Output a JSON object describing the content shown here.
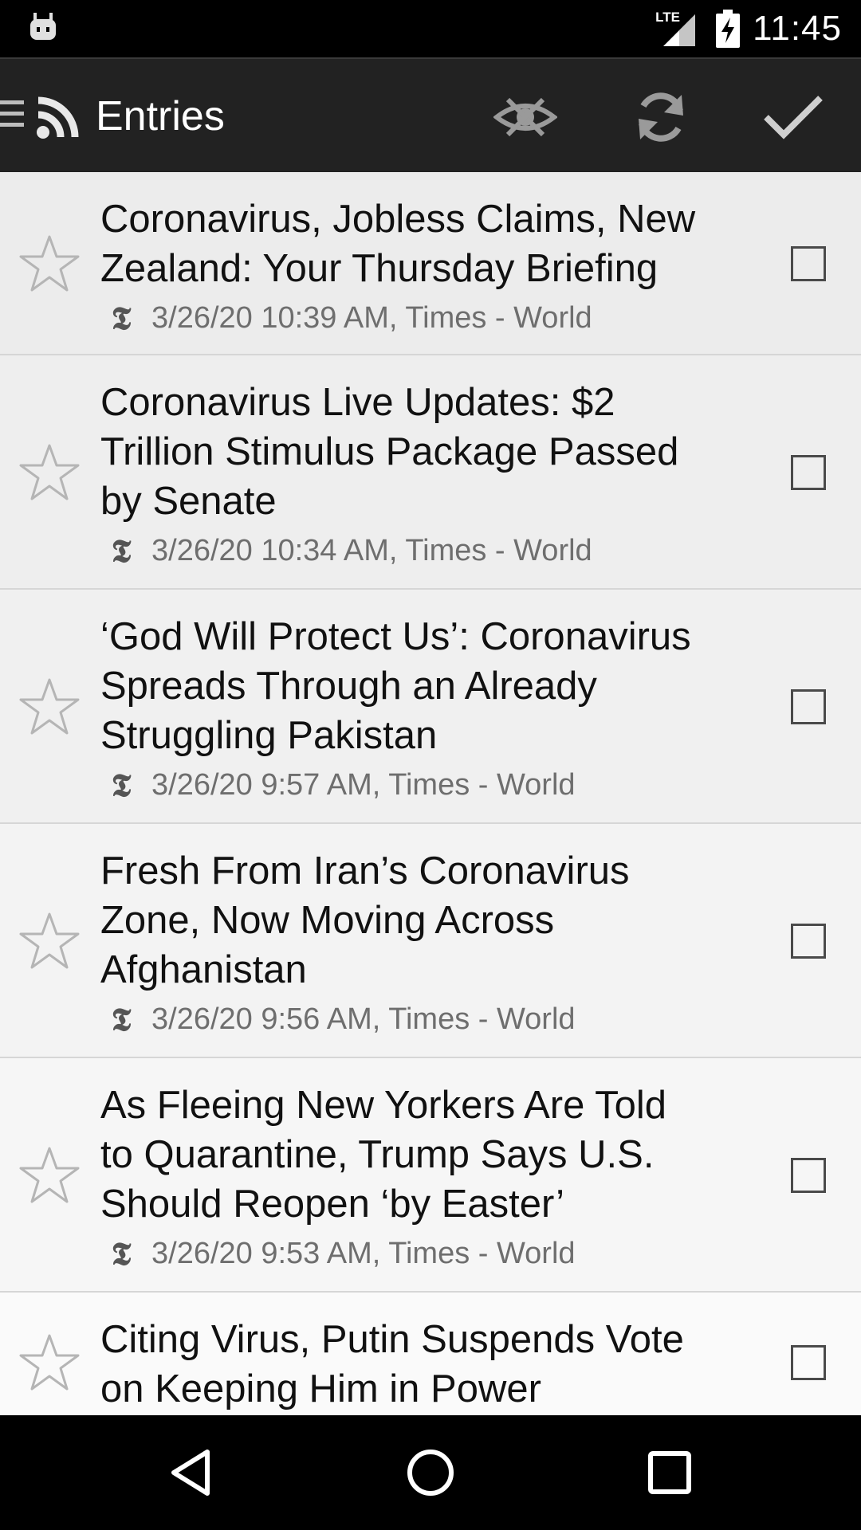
{
  "status_bar": {
    "network": "LTE",
    "time": "11:45"
  },
  "action_bar": {
    "title": "Entries",
    "icons": {
      "menu": "menu-icon",
      "feed": "rss-icon",
      "hide_read": "eye-off-icon",
      "refresh": "refresh-icon",
      "mark_all_read": "check-icon"
    }
  },
  "entries": [
    {
      "title_lines": [
        "Coronavirus, Jobless Claims, New",
        "Zealand: Your Thursday Briefing"
      ],
      "meta": "3/26/20 10:39 AM, Times - World",
      "starred": false,
      "checked": false
    },
    {
      "title_lines": [
        "Coronavirus Live Updates: $2",
        "Trillion Stimulus Package Passed",
        "by Senate"
      ],
      "meta": "3/26/20 10:34 AM, Times - World",
      "starred": false,
      "checked": false
    },
    {
      "title_lines": [
        "‘God Will Protect Us’: Coronavirus",
        "Spreads Through an Already",
        "Struggling Pakistan"
      ],
      "meta": "3/26/20 9:57 AM, Times - World",
      "starred": false,
      "checked": false
    },
    {
      "title_lines": [
        "Fresh From Iran’s Coronavirus",
        "Zone, Now Moving Across",
        "Afghanistan"
      ],
      "meta": "3/26/20 9:56 AM, Times - World",
      "starred": false,
      "checked": false
    },
    {
      "title_lines": [
        "As Fleeing New Yorkers Are Told",
        "to Quarantine, Trump Says U.S.",
        "Should Reopen ‘by Easter’"
      ],
      "meta": "3/26/20 9:53 AM, Times - World",
      "starred": false,
      "checked": false
    },
    {
      "title_lines": [
        "Citing Virus, Putin Suspends Vote",
        "on Keeping Him in Power"
      ],
      "meta": "",
      "starred": false,
      "checked": false
    }
  ],
  "feed_logo_glyph": "𝕿",
  "nav_bar": {
    "icons": [
      "back-icon",
      "home-icon",
      "recents-icon"
    ]
  }
}
